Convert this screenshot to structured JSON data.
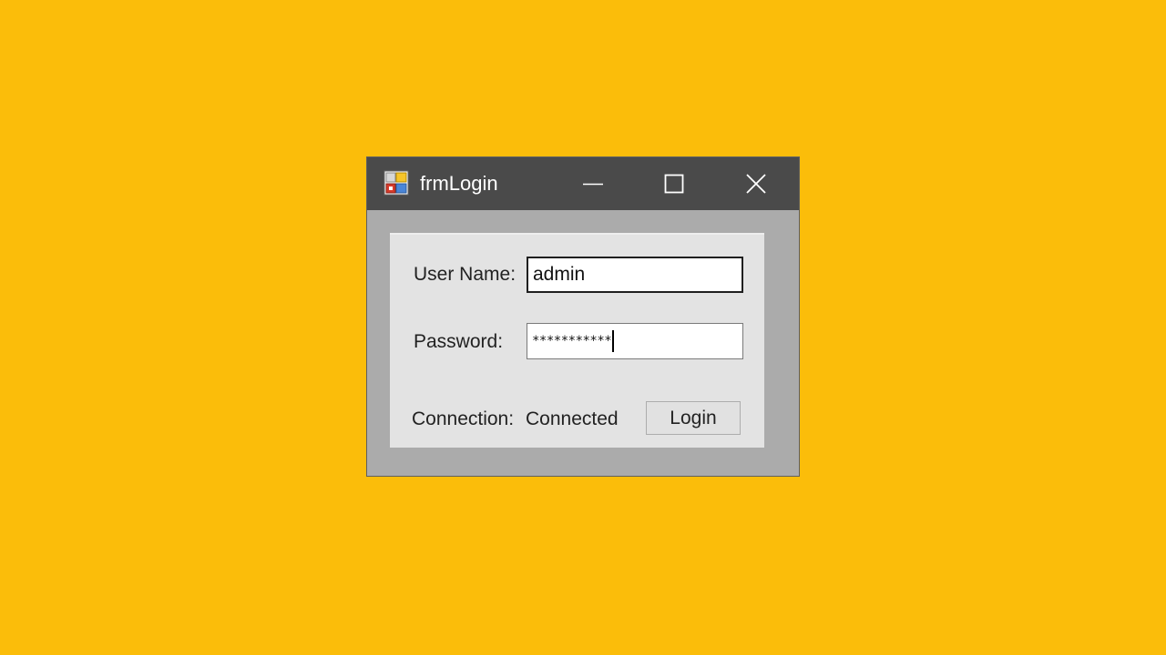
{
  "window": {
    "title": "frmLogin",
    "icon": "winforms-app-icon",
    "controls": {
      "minimize_icon": "minimize-icon",
      "maximize_icon": "maximize-icon",
      "close_icon": "close-icon"
    }
  },
  "form": {
    "username_label": "User Name:",
    "username_value": "admin",
    "password_label": "Password:",
    "password_value": "***********",
    "connection_label": "Connection:",
    "connection_status": "Connected",
    "login_label": "Login"
  },
  "colors": {
    "background": "#FBBD0A",
    "titlebar": "#4A4A4A",
    "window_frame": "#ABABAB",
    "panel": "#E3E3E3"
  }
}
